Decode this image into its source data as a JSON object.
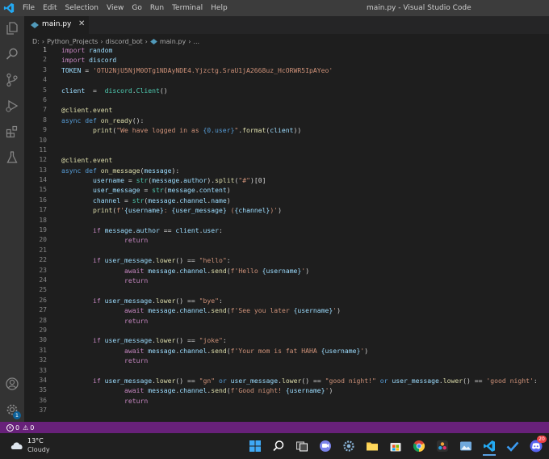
{
  "titlebar": {
    "menus": [
      "File",
      "Edit",
      "Selection",
      "View",
      "Go",
      "Run",
      "Terminal",
      "Help"
    ],
    "window_title": "main.py - Visual Studio Code"
  },
  "tab": {
    "label": "main.py"
  },
  "breadcrumb": {
    "parts": [
      "D:",
      "Python_Projects",
      "discord_bot",
      "main.py",
      "..."
    ]
  },
  "line_numbers": [
    "1",
    "2",
    "3",
    "4",
    "5",
    "6",
    "7",
    "8",
    "9",
    "10",
    "11",
    "12",
    "13",
    "14",
    "15",
    "16",
    "17",
    "18",
    "19",
    "20",
    "21",
    "22",
    "23",
    "24",
    "25",
    "26",
    "27",
    "28",
    "29",
    "30",
    "31",
    "32",
    "33",
    "34",
    "35",
    "36",
    "37"
  ],
  "code": {
    "l1": {
      "a": "import",
      "b": " random"
    },
    "l2": {
      "a": "import",
      "b": " discord"
    },
    "l3": {
      "a": "TOKEN",
      "b": " = ",
      "c": "'OTU2NjU5NjM0OTg1NDAyNDE4.Yjzctg.SraU1jA2668uz_HcORWR5IpAYeo'"
    },
    "l5": {
      "a": "client",
      "b": "  =  ",
      "c": "discord",
      "d": ".",
      "e": "Client",
      "f": "()"
    },
    "l7": {
      "a": "@client.event"
    },
    "l8": {
      "a": "async",
      "b": " ",
      "c": "def",
      "d": " ",
      "e": "on_ready",
      "f": "():"
    },
    "l9": {
      "a": "print",
      "b": "(",
      "c": "\"We have logged in as ",
      "d": "{0.user}",
      "e": "\"",
      "f": ".",
      "g": "format",
      "h": "(",
      "i": "client",
      "j": "))"
    },
    "l12": {
      "a": "@client.event"
    },
    "l13": {
      "a": "async",
      "b": " ",
      "c": "def",
      "d": " ",
      "e": "on_message",
      "f": "(",
      "g": "message",
      "h": "):"
    },
    "l14": {
      "a": "username",
      "b": " = ",
      "c": "str",
      "d": "(",
      "e": "message",
      "f": ".",
      "g": "author",
      "h": ").",
      "i": "split",
      "j": "(",
      "k": "\"#\"",
      "l": ")[0]"
    },
    "l15": {
      "a": "user_message",
      "b": " = ",
      "c": "str",
      "d": "(",
      "e": "message",
      "f": ".",
      "g": "content",
      "h": ")"
    },
    "l16": {
      "a": "channel",
      "b": " = ",
      "c": "str",
      "d": "(",
      "e": "message",
      "f": ".",
      "g": "channel",
      "h": ".",
      "i": "name",
      "j": ")"
    },
    "l17": {
      "a": "print",
      "b": "(",
      "c": "f'",
      "d": "{username}",
      "e": ": ",
      "f": "{user_message}",
      "g": " (",
      "h": "{channel}",
      "i": ")'",
      "j": ")"
    },
    "l19": {
      "a": "if",
      "b": " ",
      "c": "message",
      "d": ".",
      "e": "author",
      "f": " == ",
      "g": "client",
      "h": ".",
      "i": "user",
      "j": ":"
    },
    "l20": {
      "a": "return"
    },
    "l22": {
      "a": "if",
      "b": " ",
      "c": "user_message",
      "d": ".",
      "e": "lower",
      "f": "() == ",
      "g": "\"hello\"",
      "h": ":"
    },
    "l23": {
      "a": "await",
      "b": " ",
      "c": "message",
      "d": ".",
      "e": "channel",
      "f": ".",
      "g": "send",
      "h": "(",
      "i": "f'Hello ",
      "j": "{username}",
      "k": "'",
      "l": ")"
    },
    "l24": {
      "a": "return"
    },
    "l26": {
      "a": "if",
      "b": " ",
      "c": "user_message",
      "d": ".",
      "e": "lower",
      "f": "() == ",
      "g": "\"bye\"",
      "h": ":"
    },
    "l27": {
      "a": "await",
      "b": " ",
      "c": "message",
      "d": ".",
      "e": "channel",
      "f": ".",
      "g": "send",
      "h": "(",
      "i": "f'See you later ",
      "j": "{username}",
      "k": "'",
      "l": ")"
    },
    "l28": {
      "a": "return"
    },
    "l30": {
      "a": "if",
      "b": " ",
      "c": "user_message",
      "d": ".",
      "e": "lower",
      "f": "() == ",
      "g": "\"joke\"",
      "h": ":"
    },
    "l31": {
      "a": "await",
      "b": " ",
      "c": "message",
      "d": ".",
      "e": "channel",
      "f": ".",
      "g": "send",
      "h": "(",
      "i": "f'Your mom is fat HAHA ",
      "j": "{username}",
      "k": "'",
      "l": ")"
    },
    "l32": {
      "a": "return"
    },
    "l34": {
      "a": "if",
      "b": " ",
      "c": "user_message",
      "d": ".",
      "e": "lower",
      "f": "() == ",
      "g": "\"gn\"",
      "h": " or ",
      "i": "user_message",
      "j": ".",
      "k": "lower",
      "l": "() == ",
      "m": "\"good night!\"",
      "n": " or ",
      "o": "user_message",
      "p": ".",
      "q": "lower",
      "r": "() == ",
      "s": "'good night'",
      "t": ":"
    },
    "l35": {
      "a": "await",
      "b": " ",
      "c": "message",
      "d": ".",
      "e": "channel",
      "f": ".",
      "g": "send",
      "h": "(",
      "i": "f'Good night! ",
      "j": "{username}",
      "k": "'",
      "l": ")"
    },
    "l36": {
      "a": "return"
    }
  },
  "statusbar": {
    "errors": "0",
    "warnings": "0"
  },
  "taskbar": {
    "weather_temp": "13°C",
    "weather_desc": "Cloudy",
    "discord_badge": "20"
  },
  "accounts_badge": "1",
  "colors": {
    "titlebar": "#3c3c3c",
    "activitybar": "#333333",
    "editor_bg": "#1e1e1e",
    "statusbar": "#68217a",
    "taskbar": "#202020",
    "keyword": "#c586c0",
    "function": "#dcdcaa",
    "string": "#ce9178",
    "variable": "#9cdcfe",
    "class": "#4ec9b0"
  }
}
